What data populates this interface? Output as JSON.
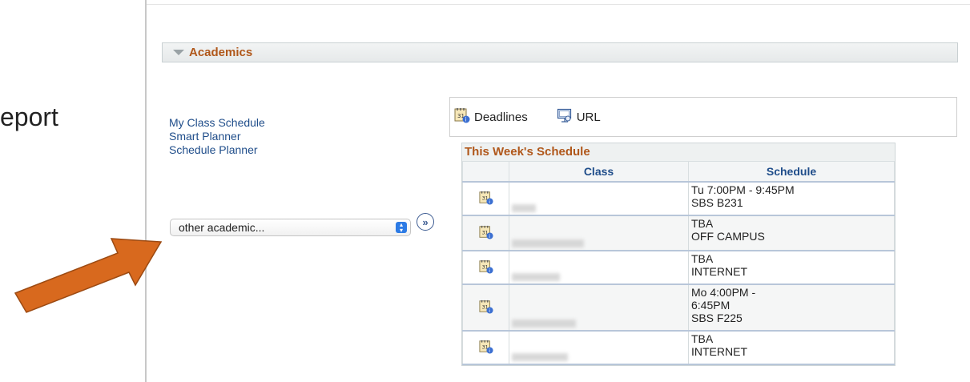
{
  "slide": {
    "left_text": "eport"
  },
  "section": {
    "title": "Academics"
  },
  "links": [
    {
      "label": "My Class Schedule"
    },
    {
      "label": "Smart Planner"
    },
    {
      "label": "Schedule Planner"
    }
  ],
  "other_select": {
    "value": "other academic..."
  },
  "tools": [
    {
      "label": "Deadlines",
      "icon": "calendar-info-icon"
    },
    {
      "label": "URL",
      "icon": "url-icon"
    }
  ],
  "schedule": {
    "title": "This Week's Schedule",
    "columns": {
      "class": "Class",
      "schedule": "Schedule"
    },
    "rows": [
      {
        "schedule": [
          "Tu 7:00PM - 9:45PM",
          "SBS B231"
        ]
      },
      {
        "schedule": [
          "TBA",
          "OFF CAMPUS"
        ]
      },
      {
        "schedule": [
          "TBA",
          "INTERNET"
        ]
      },
      {
        "schedule": [
          "Mo 4:00PM -",
          "6:45PM",
          "SBS F225"
        ]
      },
      {
        "schedule": [
          "TBA",
          "INTERNET"
        ]
      }
    ]
  },
  "colors": {
    "accent": "#b0571a",
    "link": "#1f4d8a",
    "arrow": "#d8691e"
  }
}
